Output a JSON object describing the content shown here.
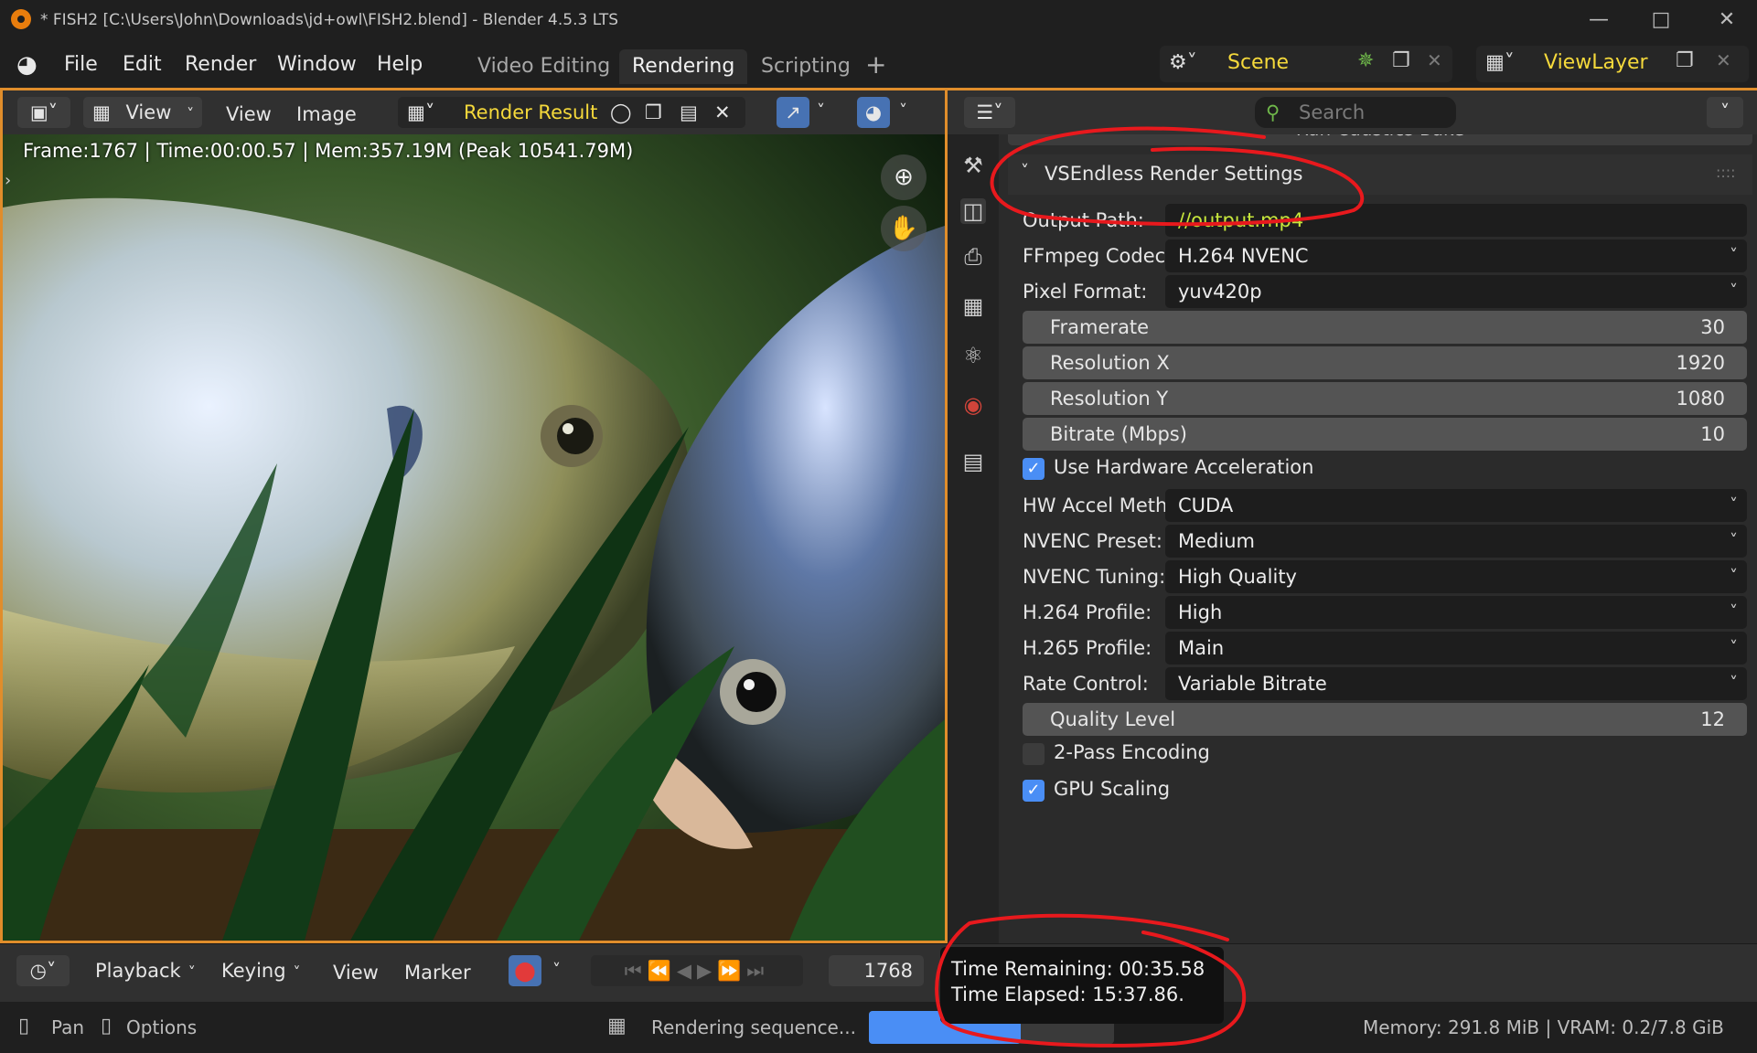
{
  "window": {
    "title": "* FISH2 [C:\\Users\\John\\Downloads\\jd+owl\\FISH2.blend] - Blender 4.5.3 LTS",
    "controls": [
      "minimize-icon",
      "maximize-icon",
      "close-icon"
    ]
  },
  "menu": {
    "items": [
      "File",
      "Edit",
      "Render",
      "Window",
      "Help"
    ],
    "workspaces": [
      "Video Editing",
      "Rendering",
      "Scripting"
    ],
    "active_workspace": "Rendering",
    "add_workspace": "+"
  },
  "scene": {
    "label": "Scene",
    "viewlayer": "ViewLayer"
  },
  "image_editor": {
    "view_menu_1": "View",
    "view_menu_2": "View",
    "image_menu": "Image",
    "image_name": "Render Result",
    "frame_info": "Frame:1767 | Time:00:00.57 | Mem:357.19M (Peak 10541.79M)"
  },
  "properties": {
    "search_placeholder": "Search",
    "cut_off_row": "Run Caustics Bake",
    "panel_title": "VSEndless Render Settings",
    "output_path_label": "Output Path:",
    "output_path_value": "//output.mp4",
    "codec_label": "FFmpeg Codec:",
    "codec_value": "H.264 NVENC",
    "pixel_format_label": "Pixel Format:",
    "pixel_format_value": "yuv420p",
    "sliders": [
      {
        "label": "Framerate",
        "value": "30"
      },
      {
        "label": "Resolution X",
        "value": "1920"
      },
      {
        "label": "Resolution Y",
        "value": "1080"
      },
      {
        "label": "Bitrate (Mbps)",
        "value": "10"
      }
    ],
    "hw_accel_checkbox": "Use Hardware Acceleration",
    "hw_accel_checked": true,
    "dropdowns": [
      {
        "label": "HW Accel Method:",
        "value": "CUDA"
      },
      {
        "label": "NVENC Preset:",
        "value": "Medium"
      },
      {
        "label": "NVENC Tuning:",
        "value": "High Quality"
      },
      {
        "label": "H.264 Profile:",
        "value": "High"
      },
      {
        "label": "H.265 Profile:",
        "value": "Main"
      },
      {
        "label": "Rate Control:",
        "value": "Variable Bitrate"
      }
    ],
    "quality_label": "Quality Level",
    "quality_value": "12",
    "two_pass_label": "2-Pass Encoding",
    "two_pass_checked": false,
    "gpu_scaling_label": "GPU Scaling",
    "gpu_scaling_checked": true
  },
  "timeline": {
    "playback": "Playback",
    "keying": "Keying",
    "view": "View",
    "marker": "Marker",
    "current_frame": "1768"
  },
  "tooltip": {
    "remaining": "Time Remaining: 00:35.58",
    "elapsed": "Time Elapsed: 15:37.86."
  },
  "status": {
    "pan": "Pan",
    "options": "Options",
    "job": "Rendering sequence...",
    "memory": "Memory: 291.8 MiB | VRAM: 0.2/7.8 GiB",
    "progress": 0.62
  },
  "colors": {
    "accent": "#e08d2b",
    "active_text": "#f5d93b",
    "checkbox": "#4a8ef5",
    "progress": "#4a8ef5",
    "annotation": "#e8191d"
  }
}
